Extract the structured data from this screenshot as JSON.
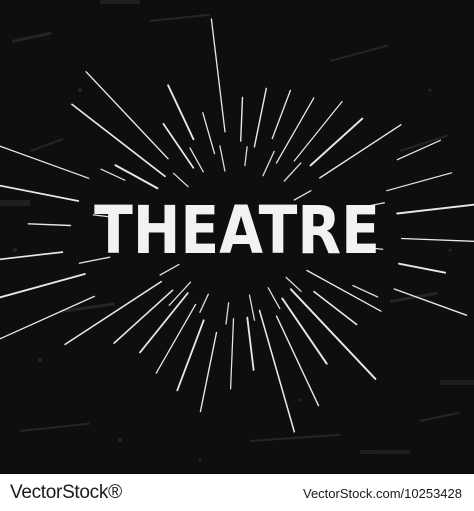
{
  "poster": {
    "title": "THEATRE",
    "background_color": "#0e0e0e",
    "text_color": "#f2f2f2",
    "ray_color": "#ffffff"
  },
  "footer": {
    "brand": "VectorStock®",
    "stock_id": "VectorStock.com/10253428",
    "text_color": "#1a1a1a"
  }
}
